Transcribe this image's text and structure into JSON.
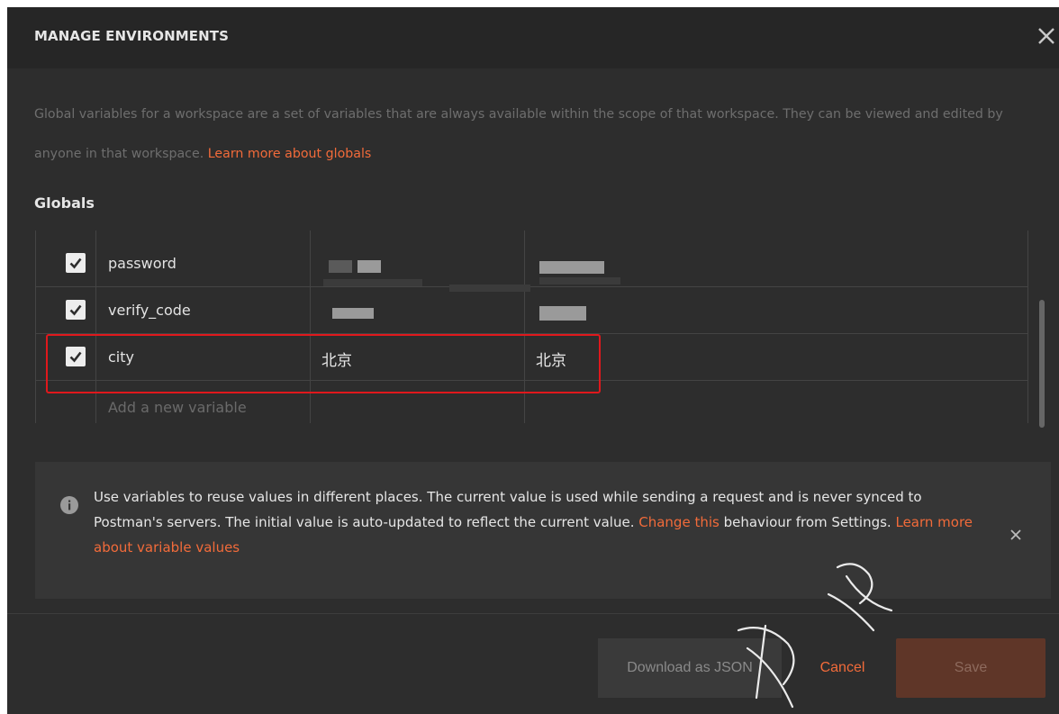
{
  "modal": {
    "title": "MANAGE ENVIRONMENTS",
    "description": "Global variables for a workspace are a set of variables that are always available within the scope of that workspace. They can be viewed and edited by anyone in that workspace.",
    "description_link": "Learn more about globals",
    "section_title": "Globals"
  },
  "variables": [
    {
      "key": "password",
      "initial": "",
      "current": "",
      "checked": true
    },
    {
      "key": "verify_code",
      "initial": "",
      "current": "",
      "checked": true
    },
    {
      "key": "city",
      "initial": "北京",
      "current": "北京",
      "checked": true
    }
  ],
  "new_variable_placeholder": "Add a new variable",
  "info": {
    "text_1": "Use variables to reuse values in different places. The current value is used while sending a request and is never synced to Postman's servers. The initial value is auto-updated to reflect the current value.",
    "link_change": "Change this",
    "text_2": "behaviour from Settings.",
    "link_learn": "Learn more about variable values"
  },
  "footer": {
    "download_label": "Download as JSON",
    "cancel_label": "Cancel",
    "save_label": "Save"
  },
  "icons": {
    "close": "close-icon",
    "info": "info-icon",
    "checkbox": "checkbox-checked-icon"
  },
  "colors": {
    "accent": "#f26b3a",
    "highlight_border": "#e0181c",
    "background": "#2d2d2d",
    "header": "#262626",
    "save_button": "#5f3628"
  }
}
